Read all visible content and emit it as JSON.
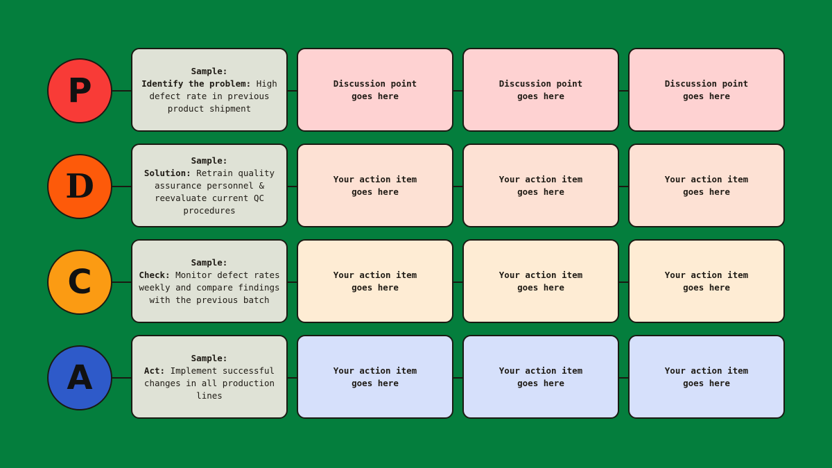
{
  "rows": [
    {
      "letter": "P",
      "circle_color": "#f83b37",
      "card_color": "#fed2d2",
      "sample": {
        "heading": "Sample:",
        "label": "Identify the problem:",
        "text": "High defect rate in previous product shipment"
      },
      "items": [
        "Discussion point\ngoes here",
        "Discussion point\ngoes here",
        "Discussion point\ngoes here"
      ]
    },
    {
      "letter": "D",
      "circle_color": "#fd5a0a",
      "card_color": "#fde1d4",
      "sample": {
        "heading": "Sample:",
        "label": "Solution:",
        "text": "Retrain quality assurance personnel & reevaluate current QC procedures"
      },
      "items": [
        "Your action item\ngoes here",
        "Your action item\ngoes here",
        "Your action item\ngoes here"
      ]
    },
    {
      "letter": "C",
      "circle_color": "#fb9b13",
      "card_color": "#feecd4",
      "sample": {
        "heading": "Sample:",
        "label": "Check:",
        "text": "Monitor defect rates weekly and compare findings with the previous batch"
      },
      "items": [
        "Your action item\ngoes here",
        "Your action item\ngoes here",
        "Your action item\ngoes here"
      ]
    },
    {
      "letter": "A",
      "circle_color": "#2e5ac9",
      "card_color": "#d6e0fb",
      "sample": {
        "heading": "Sample:",
        "label": "Act:",
        "text": "Implement successful changes in all production lines"
      },
      "items": [
        "Your action item\ngoes here",
        "Your action item\ngoes here",
        "Your action item\ngoes here"
      ]
    }
  ]
}
